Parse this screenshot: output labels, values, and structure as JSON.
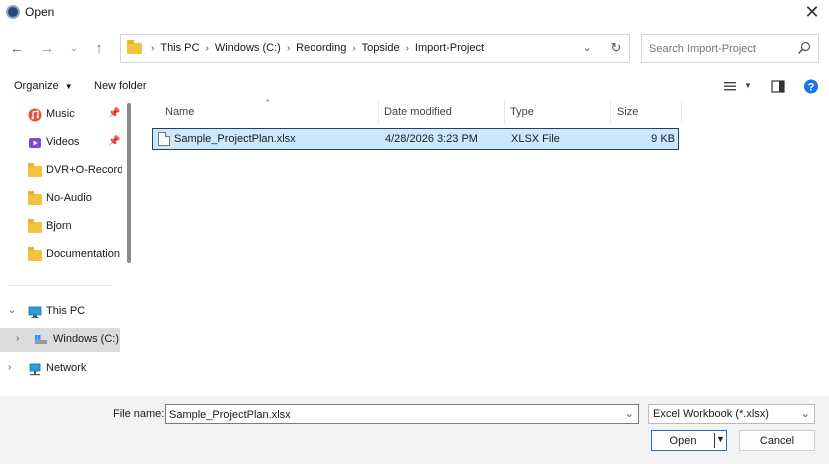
{
  "window": {
    "title": "Open"
  },
  "address": {
    "crumbs": [
      "This PC",
      "Windows (C:)",
      "Recording",
      "Topside",
      "Import-Project"
    ]
  },
  "search": {
    "placeholder": "Search Import-Project"
  },
  "toolbar": {
    "organize_label": "Organize",
    "new_folder_label": "New folder"
  },
  "sidebar": {
    "items": [
      {
        "label": "Music",
        "pinned": true
      },
      {
        "label": "Videos",
        "pinned": true
      },
      {
        "label": "DVR+O-Recordi"
      },
      {
        "label": "No-Audio"
      },
      {
        "label": "Bjorn"
      },
      {
        "label": "Documentation"
      },
      {
        "label": "This PC"
      },
      {
        "label": "Windows (C:)"
      },
      {
        "label": "Network"
      }
    ]
  },
  "columns": {
    "name": "Name",
    "date": "Date modified",
    "type": "Type",
    "size": "Size"
  },
  "files": [
    {
      "name": "Sample_ProjectPlan.xlsx",
      "date": "4/28/2026 3:23 PM",
      "type": "XLSX File",
      "size": "9 KB"
    }
  ],
  "bottom": {
    "filename_label": "File name:",
    "filename_value": "Sample_ProjectPlan.xlsx",
    "filetype_value": "Excel Workbook (*.xlsx)",
    "open_label": "Open",
    "cancel_label": "Cancel"
  },
  "colors": {
    "selection": "#cce8ff",
    "accent": "#2b6cb0",
    "help": "#1a73e8",
    "folder": "#f4c33d"
  }
}
